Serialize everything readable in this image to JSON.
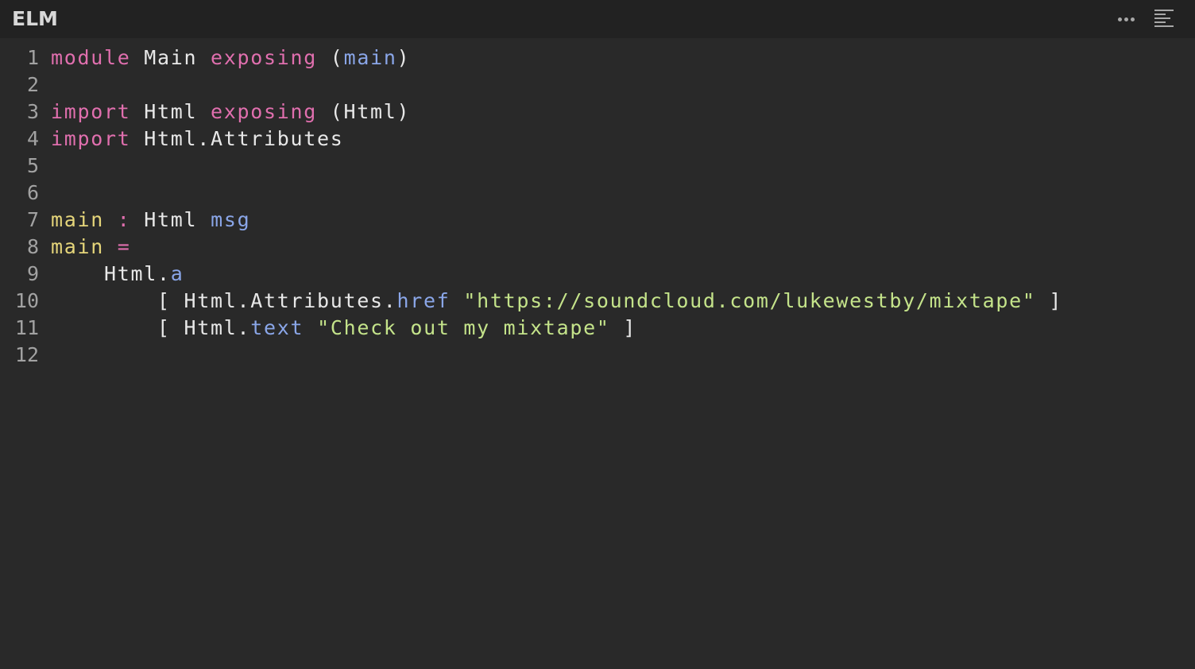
{
  "header": {
    "title": "ELM",
    "more_icon": "more-horizontal-icon",
    "format_icon": "format-align-left-icon"
  },
  "colors": {
    "background": "#292929",
    "header_background": "#222222",
    "keyword": "#e06fae",
    "function_name": "#e5d57a",
    "variable": "#8aa6e8",
    "string": "#c4e38a",
    "text": "#e8e8e8",
    "line_number": "#a2a2a2"
  },
  "code": {
    "lines": [
      {
        "number": "1",
        "tokens": [
          {
            "text": "module",
            "type": "kw"
          },
          {
            "text": " Main ",
            "type": "plain"
          },
          {
            "text": "exposing",
            "type": "kw"
          },
          {
            "text": " (",
            "type": "plain"
          },
          {
            "text": "main",
            "type": "var"
          },
          {
            "text": ")",
            "type": "plain"
          }
        ]
      },
      {
        "number": "2",
        "tokens": []
      },
      {
        "number": "3",
        "tokens": [
          {
            "text": "import",
            "type": "kw"
          },
          {
            "text": " Html ",
            "type": "plain"
          },
          {
            "text": "exposing",
            "type": "kw"
          },
          {
            "text": " (Html)",
            "type": "plain"
          }
        ]
      },
      {
        "number": "4",
        "tokens": [
          {
            "text": "import",
            "type": "kw"
          },
          {
            "text": " Html.Attributes",
            "type": "plain"
          }
        ]
      },
      {
        "number": "5",
        "tokens": []
      },
      {
        "number": "6",
        "tokens": []
      },
      {
        "number": "7",
        "tokens": [
          {
            "text": "main",
            "type": "fn"
          },
          {
            "text": " ",
            "type": "plain"
          },
          {
            "text": ":",
            "type": "op"
          },
          {
            "text": " Html ",
            "type": "plain"
          },
          {
            "text": "msg",
            "type": "var"
          }
        ]
      },
      {
        "number": "8",
        "tokens": [
          {
            "text": "main",
            "type": "fn"
          },
          {
            "text": " ",
            "type": "plain"
          },
          {
            "text": "=",
            "type": "op"
          }
        ]
      },
      {
        "number": "9",
        "tokens": [
          {
            "text": "    Html.",
            "type": "plain"
          },
          {
            "text": "a",
            "type": "var"
          }
        ]
      },
      {
        "number": "10",
        "tokens": [
          {
            "text": "        [ Html.Attributes.",
            "type": "plain"
          },
          {
            "text": "href",
            "type": "var"
          },
          {
            "text": " ",
            "type": "plain"
          },
          {
            "text": "\"https://soundcloud.com/lukewestby/mixtape\"",
            "type": "str"
          },
          {
            "text": " ]",
            "type": "plain"
          }
        ]
      },
      {
        "number": "11",
        "tokens": [
          {
            "text": "        [ Html.",
            "type": "plain"
          },
          {
            "text": "text",
            "type": "var"
          },
          {
            "text": " ",
            "type": "plain"
          },
          {
            "text": "\"Check out my mixtape\"",
            "type": "str"
          },
          {
            "text": " ]",
            "type": "plain"
          }
        ]
      },
      {
        "number": "12",
        "tokens": []
      }
    ]
  }
}
